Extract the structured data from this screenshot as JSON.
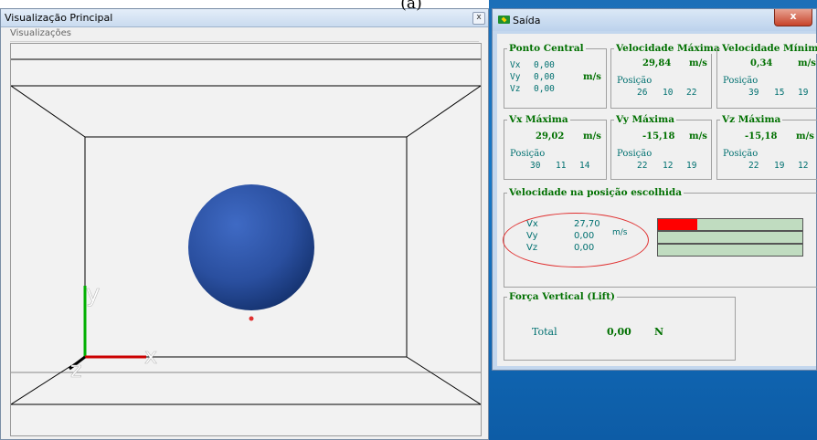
{
  "caption": "(a)",
  "left_window": {
    "title": "Visualização Principal",
    "close_label": "x",
    "menu": "Visualizações",
    "axes": {
      "y": "y",
      "x": "x",
      "z": "z"
    }
  },
  "right_window": {
    "title": "Saída",
    "close_label": "x",
    "ponto_central": {
      "title": "Ponto Central",
      "rows": [
        {
          "label": "Vx",
          "value": "0,00"
        },
        {
          "label": "Vy",
          "value": "0,00"
        },
        {
          "label": "Vz",
          "value": "0,00"
        }
      ],
      "unit": "m/s"
    },
    "vel_maxima": {
      "title": "Velocidade Máxima",
      "value": "29,84",
      "unit": "m/s",
      "pos_label": "Posição",
      "pos": [
        "26",
        "10",
        "22"
      ]
    },
    "vel_minima": {
      "title": "Velocidade Mínima",
      "value": "0,34",
      "unit": "m/s",
      "pos_label": "Posição",
      "pos": [
        "39",
        "15",
        "19"
      ]
    },
    "vx_max": {
      "title": "Vx Máxima",
      "value": "29,02",
      "unit": "m/s",
      "pos_label": "Posição",
      "pos": [
        "30",
        "11",
        "14"
      ]
    },
    "vy_max": {
      "title": "Vy Máxima",
      "value": "-15,18",
      "unit": "m/s",
      "pos_label": "Posição",
      "pos": [
        "22",
        "12",
        "19"
      ]
    },
    "vz_max": {
      "title": "Vz Máxima",
      "value": "-15,18",
      "unit": "m/s",
      "pos_label": "Posição",
      "pos": [
        "22",
        "19",
        "12"
      ]
    },
    "vel_posicao": {
      "title": "Velocidade na posição escolhida",
      "rows": [
        {
          "label": "Vx",
          "value": "27,70",
          "fill": 0.27
        },
        {
          "label": "Vy",
          "value": "0,00",
          "fill": 0
        },
        {
          "label": "Vz",
          "value": "0,00",
          "fill": 0
        }
      ],
      "unit": "m/s"
    },
    "forca": {
      "title": "Força Vertical (Lift)",
      "label": "Total",
      "value": "0,00",
      "unit": "N"
    }
  }
}
